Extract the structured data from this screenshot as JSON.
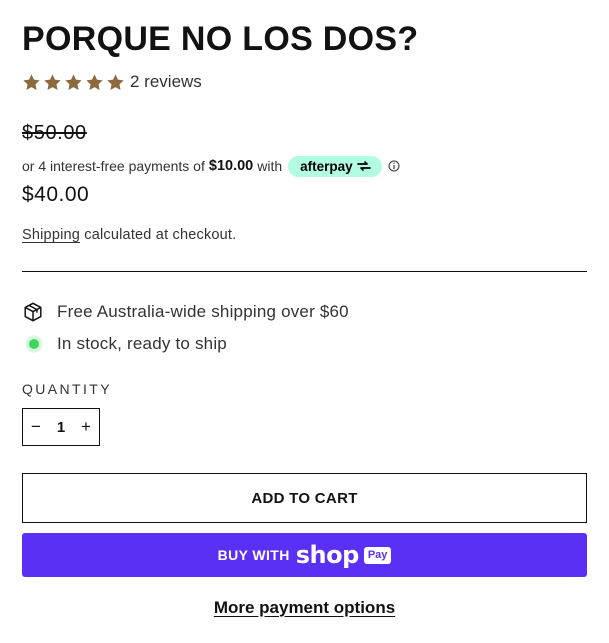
{
  "product": {
    "title": "PORQUE NO LOS DOS?",
    "rating_value": 5,
    "rating_max": 5,
    "reviews_label": "2 reviews",
    "star_color": "#8b6a3e",
    "compare_price": "$50.00",
    "afterpay": {
      "prefix": "or 4 interest-free payments of",
      "amount": "$10.00",
      "suffix": "with",
      "brand": "afterpay",
      "badge_color": "#b2fce4"
    },
    "price": "$40.00",
    "shipping_note": {
      "link_label": "Shipping",
      "text": "calculated at checkout."
    }
  },
  "features": {
    "shipping_icon": "package-icon",
    "shipping_text": "Free Australia-wide shipping over $60",
    "stock_icon": "in-stock-dot-icon",
    "stock_text": "In stock, ready to ship",
    "stock_color": "#3ed660"
  },
  "quantity": {
    "label": "QUANTITY",
    "value": "1",
    "minus": "−",
    "plus": "+"
  },
  "buttons": {
    "add_to_cart": "ADD TO CART",
    "shop_pay_prefix": "BUY WITH",
    "shop_pay_brand": "shop",
    "shop_pay_badge": "Pay",
    "shop_pay_color": "#5a31f4",
    "more_options": "More payment options"
  }
}
